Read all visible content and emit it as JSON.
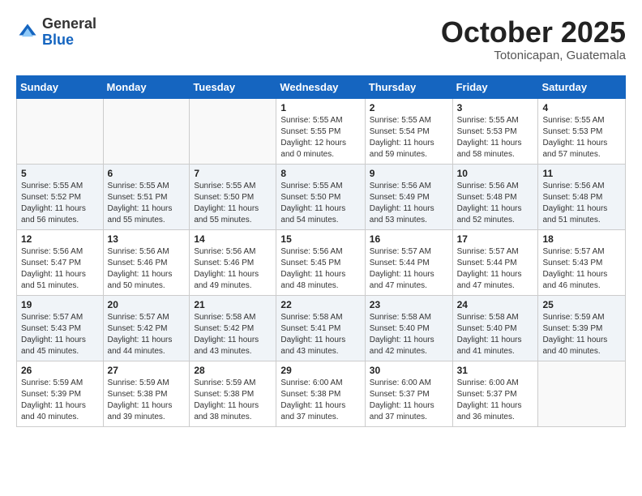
{
  "header": {
    "logo_general": "General",
    "logo_blue": "Blue",
    "month_title": "October 2025",
    "location": "Totonicapan, Guatemala"
  },
  "days_of_week": [
    "Sunday",
    "Monday",
    "Tuesday",
    "Wednesday",
    "Thursday",
    "Friday",
    "Saturday"
  ],
  "weeks": [
    [
      {
        "day": "",
        "info": ""
      },
      {
        "day": "",
        "info": ""
      },
      {
        "day": "",
        "info": ""
      },
      {
        "day": "1",
        "info": "Sunrise: 5:55 AM\nSunset: 5:55 PM\nDaylight: 12 hours\nand 0 minutes."
      },
      {
        "day": "2",
        "info": "Sunrise: 5:55 AM\nSunset: 5:54 PM\nDaylight: 11 hours\nand 59 minutes."
      },
      {
        "day": "3",
        "info": "Sunrise: 5:55 AM\nSunset: 5:53 PM\nDaylight: 11 hours\nand 58 minutes."
      },
      {
        "day": "4",
        "info": "Sunrise: 5:55 AM\nSunset: 5:53 PM\nDaylight: 11 hours\nand 57 minutes."
      }
    ],
    [
      {
        "day": "5",
        "info": "Sunrise: 5:55 AM\nSunset: 5:52 PM\nDaylight: 11 hours\nand 56 minutes."
      },
      {
        "day": "6",
        "info": "Sunrise: 5:55 AM\nSunset: 5:51 PM\nDaylight: 11 hours\nand 55 minutes."
      },
      {
        "day": "7",
        "info": "Sunrise: 5:55 AM\nSunset: 5:50 PM\nDaylight: 11 hours\nand 55 minutes."
      },
      {
        "day": "8",
        "info": "Sunrise: 5:55 AM\nSunset: 5:50 PM\nDaylight: 11 hours\nand 54 minutes."
      },
      {
        "day": "9",
        "info": "Sunrise: 5:56 AM\nSunset: 5:49 PM\nDaylight: 11 hours\nand 53 minutes."
      },
      {
        "day": "10",
        "info": "Sunrise: 5:56 AM\nSunset: 5:48 PM\nDaylight: 11 hours\nand 52 minutes."
      },
      {
        "day": "11",
        "info": "Sunrise: 5:56 AM\nSunset: 5:48 PM\nDaylight: 11 hours\nand 51 minutes."
      }
    ],
    [
      {
        "day": "12",
        "info": "Sunrise: 5:56 AM\nSunset: 5:47 PM\nDaylight: 11 hours\nand 51 minutes."
      },
      {
        "day": "13",
        "info": "Sunrise: 5:56 AM\nSunset: 5:46 PM\nDaylight: 11 hours\nand 50 minutes."
      },
      {
        "day": "14",
        "info": "Sunrise: 5:56 AM\nSunset: 5:46 PM\nDaylight: 11 hours\nand 49 minutes."
      },
      {
        "day": "15",
        "info": "Sunrise: 5:56 AM\nSunset: 5:45 PM\nDaylight: 11 hours\nand 48 minutes."
      },
      {
        "day": "16",
        "info": "Sunrise: 5:57 AM\nSunset: 5:44 PM\nDaylight: 11 hours\nand 47 minutes."
      },
      {
        "day": "17",
        "info": "Sunrise: 5:57 AM\nSunset: 5:44 PM\nDaylight: 11 hours\nand 47 minutes."
      },
      {
        "day": "18",
        "info": "Sunrise: 5:57 AM\nSunset: 5:43 PM\nDaylight: 11 hours\nand 46 minutes."
      }
    ],
    [
      {
        "day": "19",
        "info": "Sunrise: 5:57 AM\nSunset: 5:43 PM\nDaylight: 11 hours\nand 45 minutes."
      },
      {
        "day": "20",
        "info": "Sunrise: 5:57 AM\nSunset: 5:42 PM\nDaylight: 11 hours\nand 44 minutes."
      },
      {
        "day": "21",
        "info": "Sunrise: 5:58 AM\nSunset: 5:42 PM\nDaylight: 11 hours\nand 43 minutes."
      },
      {
        "day": "22",
        "info": "Sunrise: 5:58 AM\nSunset: 5:41 PM\nDaylight: 11 hours\nand 43 minutes."
      },
      {
        "day": "23",
        "info": "Sunrise: 5:58 AM\nSunset: 5:40 PM\nDaylight: 11 hours\nand 42 minutes."
      },
      {
        "day": "24",
        "info": "Sunrise: 5:58 AM\nSunset: 5:40 PM\nDaylight: 11 hours\nand 41 minutes."
      },
      {
        "day": "25",
        "info": "Sunrise: 5:59 AM\nSunset: 5:39 PM\nDaylight: 11 hours\nand 40 minutes."
      }
    ],
    [
      {
        "day": "26",
        "info": "Sunrise: 5:59 AM\nSunset: 5:39 PM\nDaylight: 11 hours\nand 40 minutes."
      },
      {
        "day": "27",
        "info": "Sunrise: 5:59 AM\nSunset: 5:38 PM\nDaylight: 11 hours\nand 39 minutes."
      },
      {
        "day": "28",
        "info": "Sunrise: 5:59 AM\nSunset: 5:38 PM\nDaylight: 11 hours\nand 38 minutes."
      },
      {
        "day": "29",
        "info": "Sunrise: 6:00 AM\nSunset: 5:38 PM\nDaylight: 11 hours\nand 37 minutes."
      },
      {
        "day": "30",
        "info": "Sunrise: 6:00 AM\nSunset: 5:37 PM\nDaylight: 11 hours\nand 37 minutes."
      },
      {
        "day": "31",
        "info": "Sunrise: 6:00 AM\nSunset: 5:37 PM\nDaylight: 11 hours\nand 36 minutes."
      },
      {
        "day": "",
        "info": ""
      }
    ]
  ]
}
